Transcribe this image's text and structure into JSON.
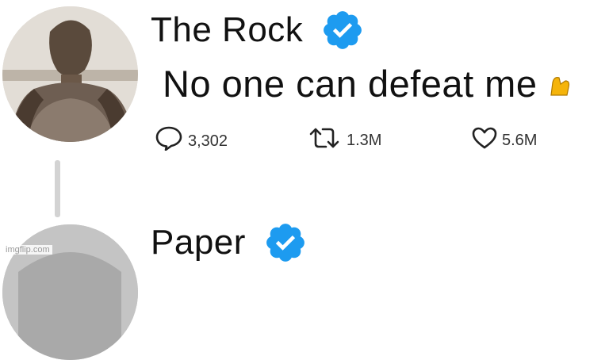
{
  "tweet": {
    "author": {
      "display_name": "The Rock",
      "verified": true,
      "avatar": "man-portrait"
    },
    "text": "No one can defeat me",
    "emoji": "flexed-biceps-emoji",
    "stats": {
      "replies": "3,302",
      "retweets": "1.3M",
      "likes": "5.6M"
    }
  },
  "reply": {
    "author": {
      "display_name": "Paper",
      "verified": true,
      "avatar": "paper-avatar"
    }
  },
  "icons": {
    "reply": "reply-icon",
    "retweet": "retweet-icon",
    "like": "heart-icon",
    "verified": "verified-badge-icon"
  },
  "colors": {
    "verified": "#1d9bf0",
    "text": "#111111",
    "muted": "#333333",
    "thread_line": "#d3d3d3"
  },
  "watermark": "imgflip.com"
}
